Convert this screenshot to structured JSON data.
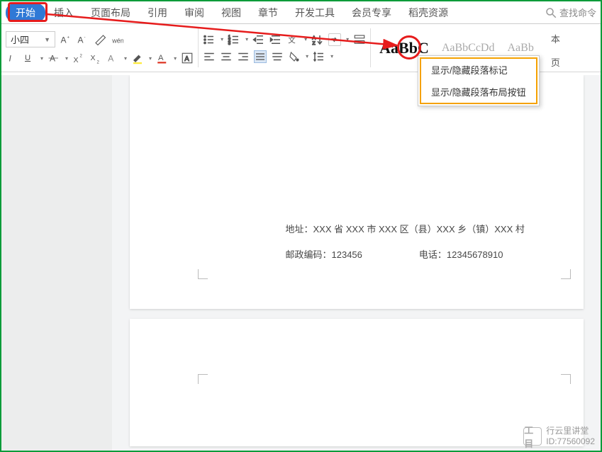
{
  "tabs": {
    "items": [
      "开始",
      "插入",
      "页面布局",
      "引用",
      "审阅",
      "视图",
      "章节",
      "开发工具",
      "会员专享",
      "稻壳资源"
    ],
    "active_index": 0
  },
  "search": {
    "placeholder": "查找命令"
  },
  "toolbar": {
    "font_size": "小四",
    "style_bold_preview": "AaBbC",
    "style_grey_preview": "AaBbCcDd",
    "style_grey_preview2": "AaBb",
    "text_label": "本",
    "page_label": "页"
  },
  "dropdown": {
    "items": [
      "显示/隐藏段落标记",
      "显示/隐藏段落布局按钮"
    ]
  },
  "document": {
    "address_label": "地址：",
    "address_value": "XXX 省 XXX 市 XXX 区（县）XXX 乡（镇）XXX 村",
    "postal_label": "邮政编码：",
    "postal_value": "123456",
    "phone_label": "电话：",
    "phone_value": "12345678910"
  },
  "watermark": {
    "logo": "工目",
    "line1": "行云里讲堂",
    "line2_label": "ID:",
    "line2_value": "77560092"
  }
}
